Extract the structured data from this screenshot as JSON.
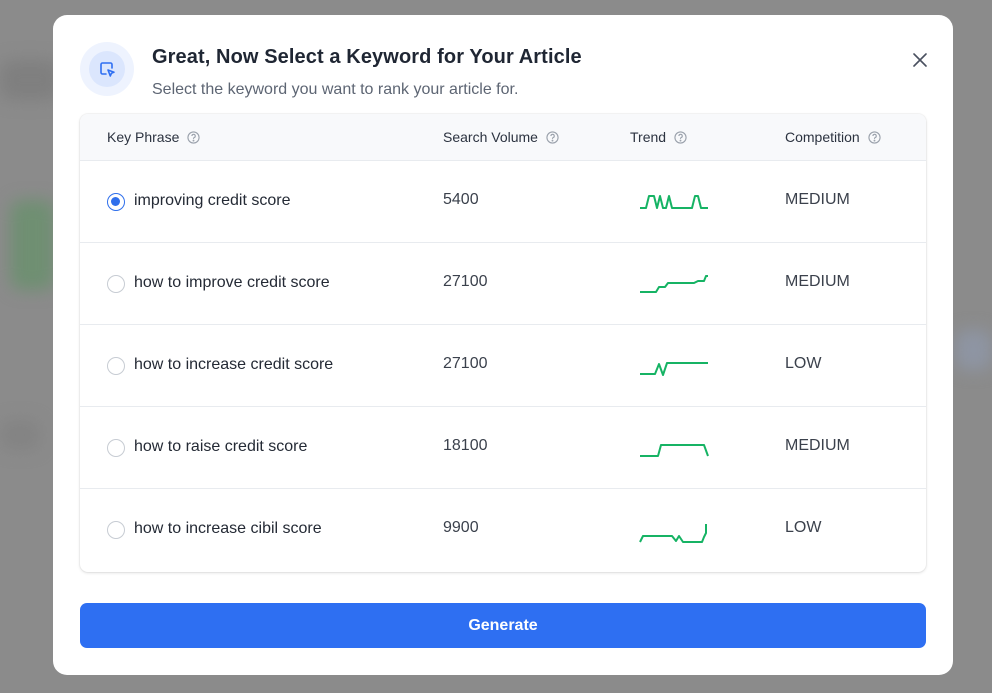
{
  "modal": {
    "title": "Great, Now Select a Keyword for Your Article",
    "subtitle": "Select the keyword you want to rank your article for.",
    "header_icon": "cursor-select-icon",
    "close_icon": "close-icon"
  },
  "table": {
    "columns": [
      {
        "label": "Key Phrase",
        "help_icon": "help-circle-icon"
      },
      {
        "label": "Search Volume",
        "help_icon": "help-circle-icon"
      },
      {
        "label": "Trend",
        "help_icon": "help-circle-icon"
      },
      {
        "label": "Competition",
        "help_icon": "help-circle-icon"
      }
    ],
    "rows": [
      {
        "phrase": "improving credit score",
        "volume": "5400",
        "competition": "MEDIUM",
        "selected": true
      },
      {
        "phrase": "how to improve credit score",
        "volume": "27100",
        "competition": "MEDIUM",
        "selected": false
      },
      {
        "phrase": "how to increase credit score",
        "volume": "27100",
        "competition": "LOW",
        "selected": false
      },
      {
        "phrase": "how to raise credit score",
        "volume": "18100",
        "competition": "MEDIUM",
        "selected": false
      },
      {
        "phrase": "how to increase cibil score",
        "volume": "9900",
        "competition": "LOW",
        "selected": false
      }
    ]
  },
  "actions": {
    "generate_label": "Generate"
  },
  "colors": {
    "accent": "#2e6ff2",
    "trend_line": "#16b364",
    "overlay": "#8a8a8a"
  }
}
